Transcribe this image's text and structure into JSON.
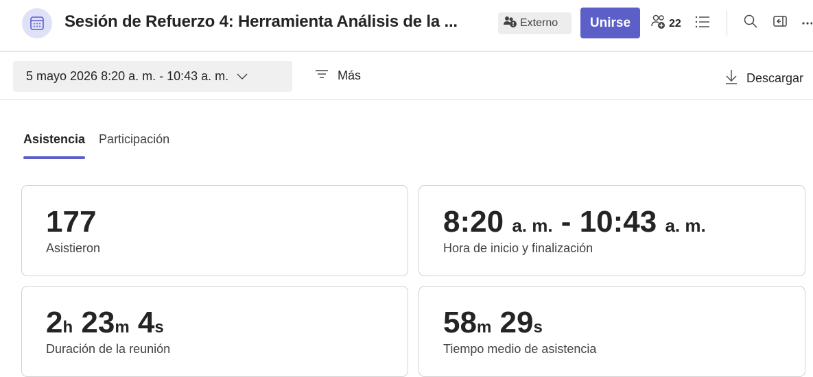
{
  "header": {
    "title": "Sesión de Refuerzo 4: Herramienta Análisis de la ...",
    "badge_label": "Externo",
    "join_label": "Unirse",
    "participants_count": "22",
    "icons": [
      "calendar-icon",
      "external-people-icon",
      "people-add-icon",
      "list-icon",
      "search-icon",
      "side-panel-icon",
      "more-icon"
    ]
  },
  "toolbar": {
    "date_range": "5 mayo 2026 8:20 a. m. - 10:43 a. m.",
    "more_label": "Más",
    "download_label": "Descargar"
  },
  "tabs": [
    {
      "label": "Asistencia",
      "active": true
    },
    {
      "label": "Participación",
      "active": false
    }
  ],
  "stats": {
    "attended": {
      "value": "177",
      "label": "Asistieron"
    },
    "time_range": {
      "start": "8:20",
      "start_ampm": "a. m.",
      "separator": "-",
      "end": "10:43",
      "end_ampm": "a. m.",
      "label": "Hora de inicio y finalización"
    },
    "duration": {
      "h": "2",
      "h_unit": "h",
      "m": "23",
      "m_unit": "m",
      "s": "4",
      "s_unit": "s",
      "label": "Duración de la reunión"
    },
    "avg_attendance": {
      "m": "58",
      "m_unit": "m",
      "s": "29",
      "s_unit": "s",
      "label": "Tiempo medio de asistencia"
    }
  },
  "colors": {
    "accent": "#5b5fc7",
    "icon_bg": "#dfe1f8"
  }
}
